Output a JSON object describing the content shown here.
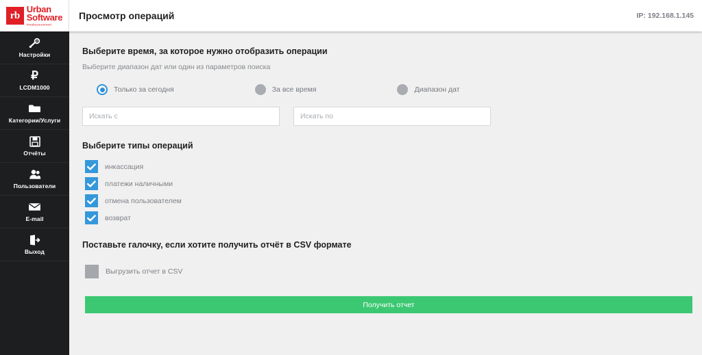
{
  "header": {
    "logo": {
      "mark": "rb",
      "line1": "Urban",
      "line2": "Software",
      "tagline": "#makeyoursmart"
    },
    "title": "Просмотр операций",
    "ip": "IP: 192.168.1.145"
  },
  "sidebar": {
    "items": [
      {
        "label": "Настройки",
        "icon": "settings-icon"
      },
      {
        "label": "LCDM1000",
        "icon": "ruble-icon"
      },
      {
        "label": "Категории/Услуги",
        "icon": "folder-icon"
      },
      {
        "label": "Отчёты",
        "icon": "save-icon"
      },
      {
        "label": "Пользователи",
        "icon": "users-icon"
      },
      {
        "label": "E-mail",
        "icon": "envelope-icon"
      },
      {
        "label": "Выход",
        "icon": "logout-icon"
      }
    ]
  },
  "main": {
    "time_section": {
      "heading": "Выберите время, за которое нужно отобразить операции",
      "subheading": "Выберите диапазон дат или один из параметров поиска",
      "radios": [
        {
          "label": "Только за сегодня",
          "selected": true
        },
        {
          "label": "За все время",
          "selected": false
        },
        {
          "label": "Диапазон дат",
          "selected": false
        }
      ],
      "date_from": {
        "placeholder": "Искать с",
        "value": ""
      },
      "date_to": {
        "placeholder": "Искать по",
        "value": ""
      }
    },
    "types_section": {
      "heading": "Выберите типы операций",
      "checkboxes": [
        {
          "label": "инкассация",
          "checked": true
        },
        {
          "label": "платежи наличными",
          "checked": true
        },
        {
          "label": "отмена пользователем",
          "checked": true
        },
        {
          "label": "возврат",
          "checked": true
        }
      ]
    },
    "csv_section": {
      "heading": "Поставьте галочку, если хотите получить отчёт в CSV формате",
      "checkbox": {
        "label": "Выгрузить отчет в CSV",
        "checked": false
      }
    },
    "submit_label": "Получить отчет"
  },
  "colors": {
    "accent_blue": "#3498db",
    "brand_red": "#e01f26",
    "success_green": "#3cc873",
    "sidebar_dark": "#1d1e20"
  }
}
